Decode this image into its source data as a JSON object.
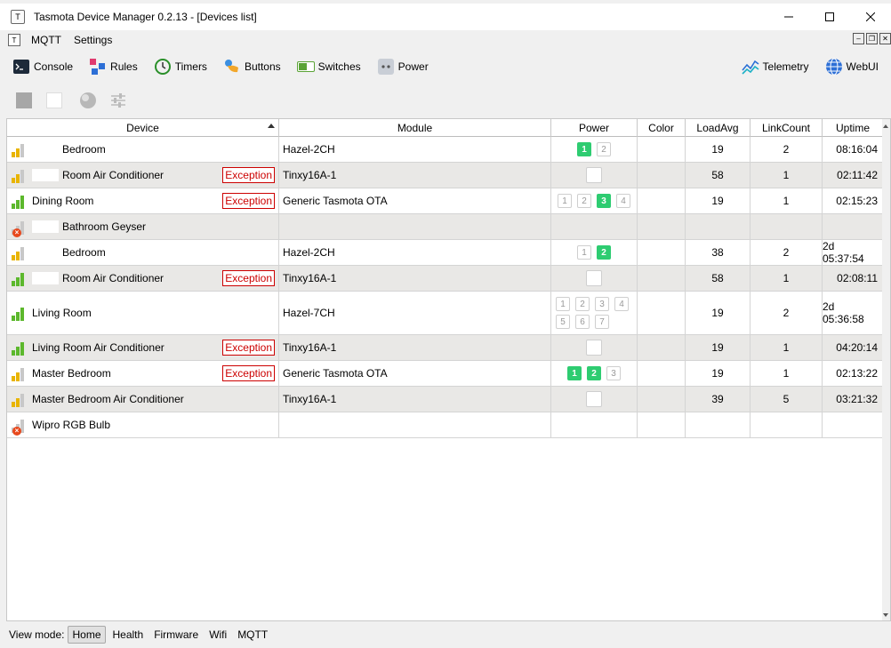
{
  "window": {
    "title": "Tasmota Device Manager 0.2.13 - [Devices list]",
    "app_icon": "T"
  },
  "menu": {
    "items": [
      "MQTT",
      "Settings"
    ]
  },
  "toolbar": {
    "left": [
      {
        "label": "Console",
        "icon": "console-icon"
      },
      {
        "label": "Rules",
        "icon": "rules-icon"
      },
      {
        "label": "Timers",
        "icon": "timers-icon"
      },
      {
        "label": "Buttons",
        "icon": "buttons-icon"
      },
      {
        "label": "Switches",
        "icon": "switches-icon"
      },
      {
        "label": "Power",
        "icon": "power-icon"
      }
    ],
    "right": [
      {
        "label": "Telemetry",
        "icon": "telemetry-icon"
      },
      {
        "label": "WebUI",
        "icon": "globe-icon"
      }
    ]
  },
  "table": {
    "columns": [
      "Device",
      "Module",
      "Power",
      "Color",
      "LoadAvg",
      "LinkCount",
      "Uptime"
    ],
    "exception_label": "Exception",
    "rows": [
      {
        "device": "Bedroom",
        "masked": true,
        "signal": "yellow",
        "exception": false,
        "module": "Hazel-2CH",
        "power": [
          {
            "n": "1",
            "on": true
          },
          {
            "n": "2",
            "on": false
          }
        ],
        "load": "19",
        "link": "2",
        "uptime": "08:16:04"
      },
      {
        "device": "Room Air Conditioner",
        "masked": true,
        "signal": "yellow",
        "exception": true,
        "module": "Tinxy16A-1",
        "power": [
          {
            "n": "",
            "on": false
          }
        ],
        "load": "58",
        "link": "1",
        "uptime": "02:11:42"
      },
      {
        "device": "Dining Room",
        "masked": false,
        "signal": "green",
        "exception": true,
        "module": "Generic Tasmota OTA",
        "power": [
          {
            "n": "1",
            "on": false
          },
          {
            "n": "2",
            "on": false
          },
          {
            "n": "3",
            "on": true
          },
          {
            "n": "4",
            "on": false
          }
        ],
        "load": "19",
        "link": "1",
        "uptime": "02:15:23"
      },
      {
        "device": "Bathroom Geyser",
        "masked": true,
        "signal": "offline",
        "exception": false,
        "module": "",
        "power": [],
        "load": "",
        "link": "",
        "uptime": ""
      },
      {
        "device": "Bedroom",
        "masked": true,
        "signal": "yellow",
        "exception": false,
        "module": "Hazel-2CH",
        "power": [
          {
            "n": "1",
            "on": false
          },
          {
            "n": "2",
            "on": true
          }
        ],
        "load": "38",
        "link": "2",
        "uptime": "2d 05:37:54"
      },
      {
        "device": "Room Air Conditioner",
        "masked": true,
        "signal": "green",
        "exception": true,
        "module": "Tinxy16A-1",
        "power": [
          {
            "n": "",
            "on": false
          }
        ],
        "load": "58",
        "link": "1",
        "uptime": "02:08:11"
      },
      {
        "device": "Living Room",
        "masked": false,
        "signal": "green",
        "exception": false,
        "module": "Hazel-7CH",
        "power": [
          {
            "n": "1",
            "on": false
          },
          {
            "n": "2",
            "on": false
          },
          {
            "n": "3",
            "on": false
          },
          {
            "n": "4",
            "on": false
          },
          {
            "n": "5",
            "on": false
          },
          {
            "n": "6",
            "on": false
          },
          {
            "n": "7",
            "on": false
          }
        ],
        "load": "19",
        "link": "2",
        "uptime": "2d 05:36:58",
        "tall": true
      },
      {
        "device": "Living Room Air Conditioner",
        "masked": false,
        "signal": "green",
        "exception": true,
        "module": "Tinxy16A-1",
        "power": [
          {
            "n": "",
            "on": false
          }
        ],
        "load": "19",
        "link": "1",
        "uptime": "04:20:14"
      },
      {
        "device": "Master Bedroom",
        "masked": false,
        "signal": "yellow",
        "exception": true,
        "module": "Generic Tasmota OTA",
        "power": [
          {
            "n": "1",
            "on": true
          },
          {
            "n": "2",
            "on": true
          },
          {
            "n": "3",
            "on": false
          }
        ],
        "load": "19",
        "link": "1",
        "uptime": "02:13:22"
      },
      {
        "device": "Master Bedroom Air Conditioner",
        "masked": false,
        "signal": "yellow",
        "exception": false,
        "module": "Tinxy16A-1",
        "power": [
          {
            "n": "",
            "on": false
          }
        ],
        "load": "39",
        "link": "5",
        "uptime": "03:21:32"
      },
      {
        "device": "Wipro RGB Bulb",
        "masked": false,
        "signal": "offline",
        "exception": false,
        "module": "",
        "power": [],
        "load": "",
        "link": "",
        "uptime": ""
      }
    ]
  },
  "statusbar": {
    "label": "View mode:",
    "modes": [
      "Home",
      "Health",
      "Firmware",
      "Wifi",
      "MQTT"
    ],
    "active": "Home"
  },
  "colors": {
    "on": "#2ecc71",
    "exception": "#cc0000",
    "signal_yellow": "#e8b400",
    "signal_green": "#5cb82c",
    "signal_empty": "#c8c8c8"
  }
}
